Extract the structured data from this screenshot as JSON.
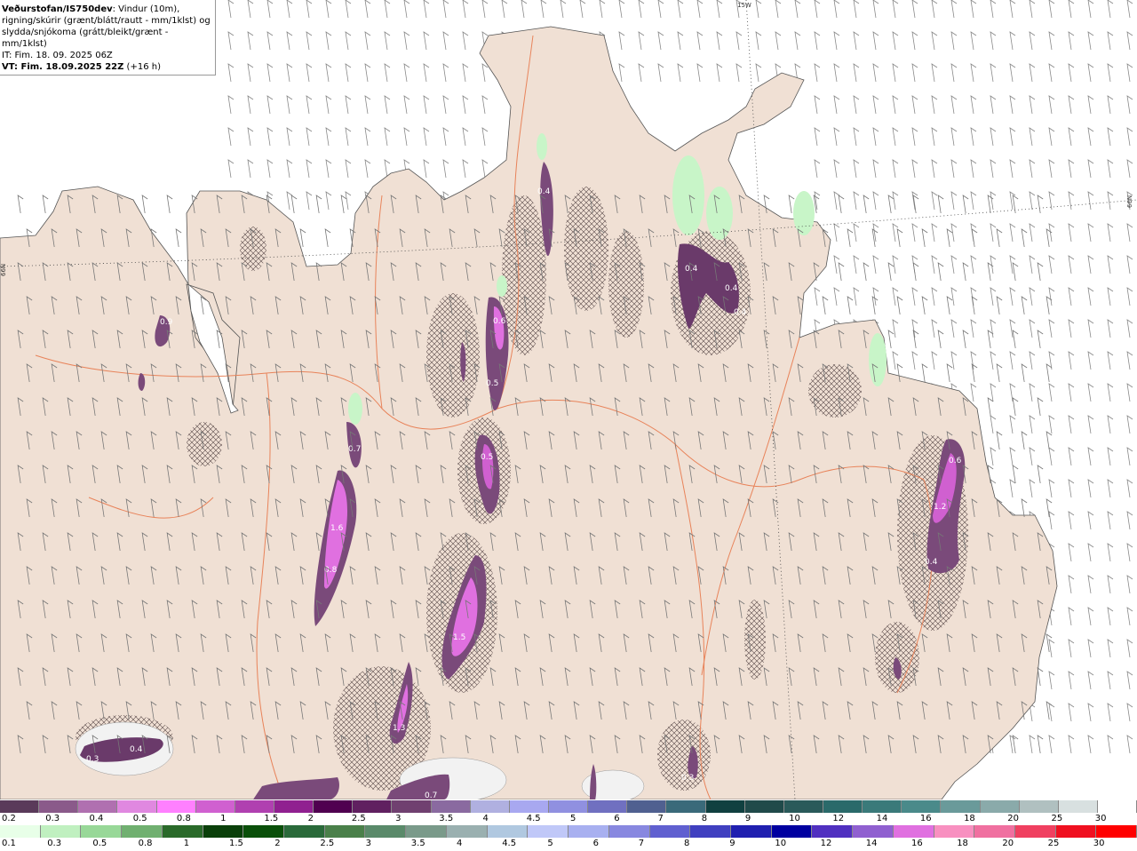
{
  "info": {
    "brand": "Veðurstofan/IS750dev",
    "line1_rest": ": Vindur (10m),",
    "line2": "rigning/skúrir (grænt/blátt/rautt - mm/1klst) og",
    "line3": "slydda/snjókoma (grátt/bleikt/grænt - mm/1klst)",
    "it": "IT: Fim. 18. 09. 2025 06Z",
    "vt": "VT: Fim. 18.09.2025 22Z",
    "vt_rest": " (+16 h)"
  },
  "graticule": {
    "lon": "15W",
    "lat_left": "66N",
    "lat_right": "66N"
  },
  "legend_top": {
    "colors": [
      "#5a3a5a",
      "#8a5a8a",
      "#b070b0",
      "#e088e0",
      "#ff80ff",
      "#d060d0",
      "#b040b0",
      "#902090",
      "#500050",
      "#602060",
      "#704070",
      "#8a6aa0",
      "#b0b0e0",
      "#a8a8f0",
      "#9090e0",
      "#7070c0",
      "#506090",
      "#3a6a7a",
      "#104040",
      "#204a4a",
      "#2a5a5a",
      "#2a6a6a",
      "#3a7a7a",
      "#4a8a8a",
      "#6a9a9a",
      "#8aaaaa",
      "#b0c0c0",
      "#d8e0e0",
      "#ffffff"
    ],
    "labels": [
      "0.2",
      "0.3",
      "0.4",
      "0.5",
      "0.8",
      "1",
      "1.5",
      "2",
      "2.5",
      "3",
      "3.5",
      "4",
      "4.5",
      "5",
      "6",
      "7",
      "8",
      "9",
      "10",
      "12",
      "14",
      "16",
      "18",
      "20",
      "25",
      "30"
    ]
  },
  "legend_bottom": {
    "colors": [
      "#e8ffe8",
      "#c0f0c0",
      "#98d898",
      "#70b070",
      "#2a6a2a",
      "#0a400a",
      "#0a500a",
      "#2a6a3a",
      "#4a804a",
      "#5a8a6a",
      "#7a9a8a",
      "#9ab0b0",
      "#b0c8e0",
      "#c0c8f8",
      "#a8b0f0",
      "#8888e0",
      "#6060d0",
      "#4040c0",
      "#2020b0",
      "#0000a0",
      "#5030c0",
      "#9060d0",
      "#e070e0",
      "#f890c0",
      "#f070a0",
      "#f04060",
      "#f01020",
      "#ff0000"
    ],
    "labels": [
      "0.1",
      "0.3",
      "0.5",
      "0.8",
      "1",
      "1.5",
      "2",
      "2.5",
      "3",
      "3.5",
      "4",
      "4.5",
      "5",
      "6",
      "7",
      "8",
      "9",
      "10",
      "12",
      "14",
      "16",
      "18",
      "20",
      "25",
      "30"
    ]
  },
  "precip_labels": [
    "0.4",
    "0.4",
    "0.4",
    "0.4",
    "0.6",
    "0.5",
    "0.5",
    "0.7",
    "1.6",
    "0.8",
    "1.5",
    "1.3",
    "0.7",
    "0.3",
    "0.4",
    "0.3",
    "0.6",
    "1.2",
    "0.4",
    "0.9"
  ]
}
